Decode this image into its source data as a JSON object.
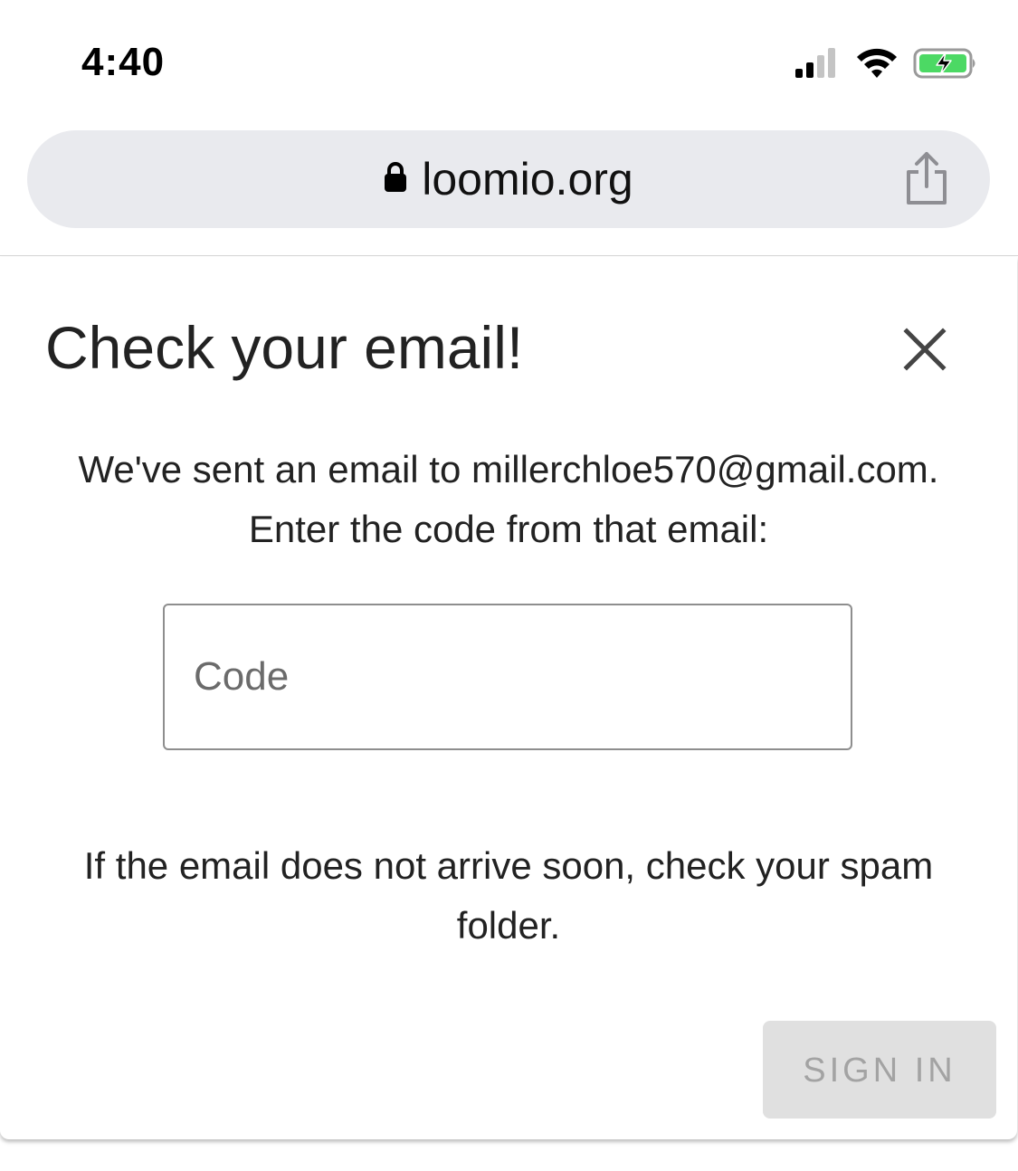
{
  "status_bar": {
    "time": "4:40",
    "icons": [
      "cellular-signal-icon",
      "wifi-icon",
      "battery-charging-icon"
    ]
  },
  "browser": {
    "url": "loomio.org",
    "icons": [
      "lock-icon",
      "share-icon"
    ]
  },
  "dialog": {
    "title": "Check your email!",
    "message_line1": "We've sent an email to millerchloe570@gmail.com.",
    "message_line2": "Enter the code from that email:",
    "code_input": {
      "placeholder": "Code",
      "value": ""
    },
    "spam_note": "If the email does not arrive soon, check your spam folder.",
    "sign_in_label": "SIGN IN",
    "sign_in_disabled": true
  },
  "colors": {
    "battery_fill": "#4cd964",
    "url_bar_bg": "#e9eaee",
    "button_disabled_bg": "#e0e0e0",
    "button_disabled_text": "#a3a3a3"
  }
}
